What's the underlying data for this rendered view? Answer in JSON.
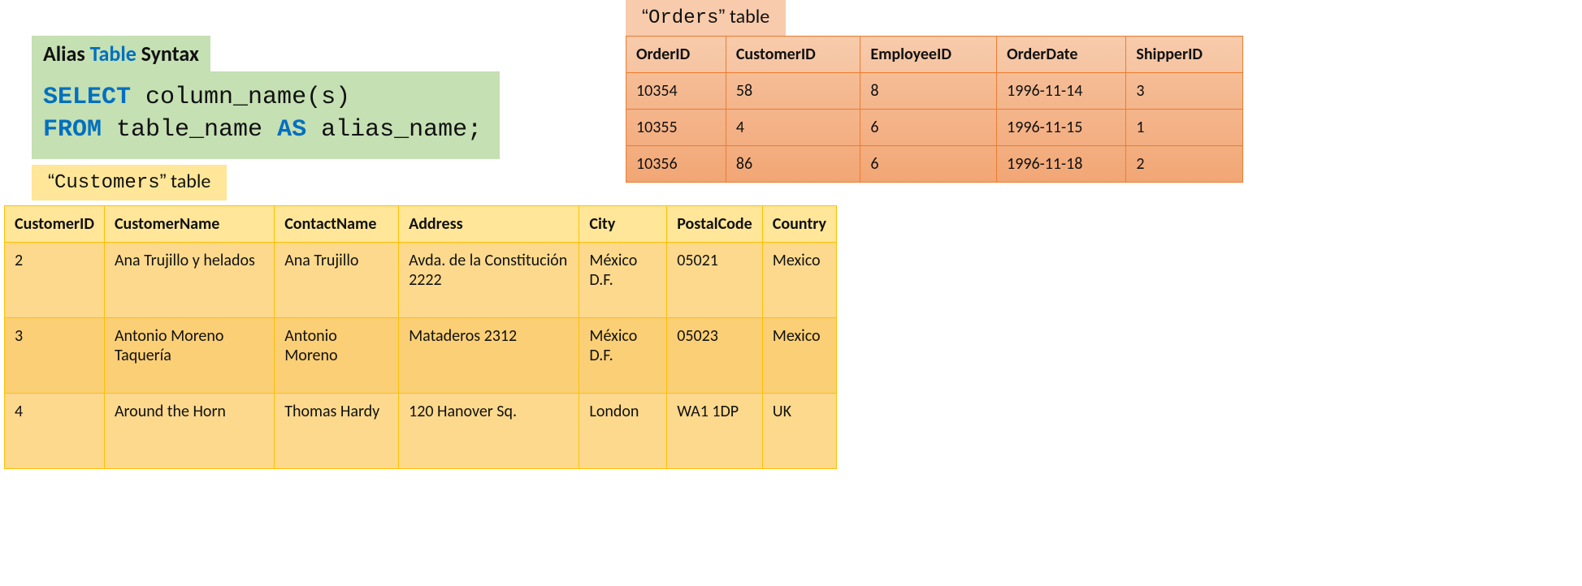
{
  "syntax": {
    "heading_prefix": "Alias ",
    "heading_kw": "Table",
    "heading_suffix": " Syntax",
    "line1_kw": "SELECT",
    "line1_rest": " column_name(s)",
    "line2_kw1": "FROM",
    "line2_mid": " table_name ",
    "line2_kw2": "AS",
    "line2_rest": " alias_name;"
  },
  "customers_tab": {
    "open_q": "“",
    "name": "Customers",
    "close_q": "”",
    "suffix": " table"
  },
  "orders_tab": {
    "open_q": "“",
    "name": "Orders",
    "close_q": "”",
    "suffix": " table"
  },
  "customers": {
    "headers": [
      "CustomerID",
      "CustomerName",
      "ContactName",
      "Address",
      "City",
      "PostalCode",
      "Country"
    ],
    "rows": [
      [
        "2",
        "Ana Trujillo y helados",
        "Ana Trujillo",
        "Avda. de la Constitución 2222",
        "México D.F.",
        "05021",
        "Mexico"
      ],
      [
        "3",
        "Antonio Moreno Taquería",
        "Antonio Moreno",
        "Mataderos 2312",
        "México D.F.",
        "05023",
        "Mexico"
      ],
      [
        "4",
        "Around the Horn",
        "Thomas Hardy",
        "120 Hanover Sq.",
        "London",
        "WA1 1DP",
        "UK"
      ]
    ]
  },
  "orders": {
    "headers": [
      "OrderID",
      "CustomerID",
      "EmployeeID",
      "OrderDate",
      "ShipperID"
    ],
    "rows": [
      [
        "10354",
        "58",
        "8",
        "1996-11-14",
        "3"
      ],
      [
        "10355",
        "4",
        "6",
        "1996-11-15",
        "1"
      ],
      [
        "10356",
        "86",
        "6",
        "1996-11-18",
        "2"
      ]
    ]
  }
}
